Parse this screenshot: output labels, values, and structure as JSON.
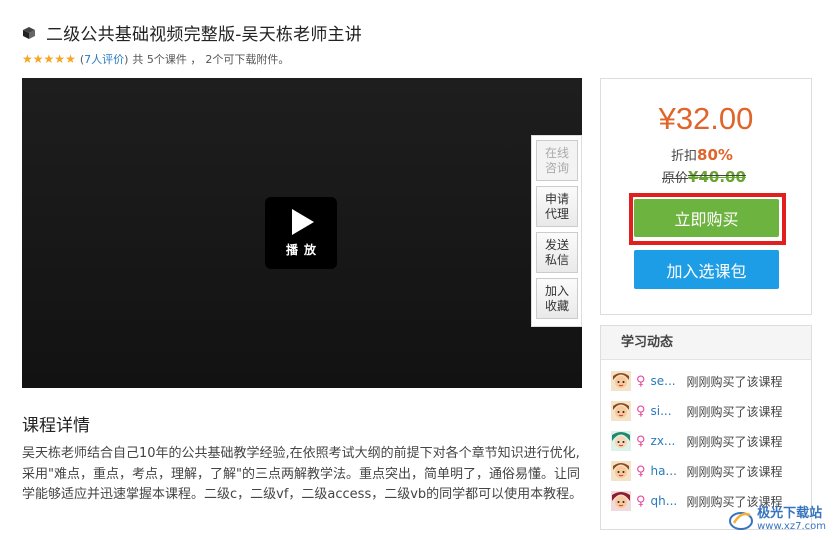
{
  "course": {
    "title": "二级公共基础视频完整版-吴天栋老师主讲",
    "rating_stars": 5,
    "reviews_link": "7人评价",
    "lessons_text": "共 5个课件 ，",
    "attachments_text": "2个可下载附件。",
    "paren_open": "(",
    "paren_close": ")"
  },
  "player": {
    "play_label": "播放"
  },
  "side_tools": [
    {
      "label": "在线咨询",
      "disabled": true
    },
    {
      "label": "申请代理",
      "disabled": false
    },
    {
      "label": "发送私信",
      "disabled": false
    },
    {
      "label": "加入收藏",
      "disabled": false
    }
  ],
  "pricing": {
    "price": "¥32.00",
    "discount_label": "折扣",
    "discount_value": "80%",
    "original_label": "原价",
    "original_value": "¥40.00",
    "buy_button": "立即购买",
    "cart_button": "加入选课包"
  },
  "activity": {
    "header": "学习动态",
    "items": [
      {
        "user": "se...",
        "action": "刚刚购买了该课程"
      },
      {
        "user": "si...",
        "action": "刚刚购买了该课程"
      },
      {
        "user": "zx...",
        "action": "刚刚购买了该课程"
      },
      {
        "user": "ha...",
        "action": "刚刚购买了该课程"
      },
      {
        "user": "qh...",
        "action": "刚刚购买了该课程"
      }
    ]
  },
  "details": {
    "title": "课程详情",
    "body": "吴天栋老师结合自己10年的公共基础教学经验,在依照考试大纲的前提下对各个章节知识进行优化,采用\"难点，重点，考点，理解，了解\"的三点两解教学法。重点突出，简单明了，通俗易懂。让同学能够适应并迅速掌握本课程。二级c，二级vf，二级access，二级vb的同学都可以使用本教程。"
  },
  "watermark": {
    "text": "极光下载站",
    "url": "www.xz7.com"
  },
  "colors": {
    "price": "#e0652a",
    "buy": "#6db33f",
    "cart": "#1d9de6",
    "highlight": "#e21f1f",
    "link": "#2a7ac0"
  }
}
